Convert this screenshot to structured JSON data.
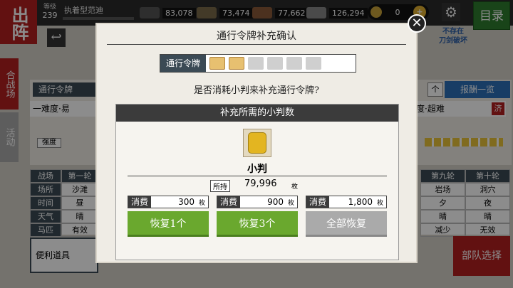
{
  "topbar": {
    "sortie": "出阵",
    "level_label": "等级",
    "level": "239",
    "player_name": "执着型范迪",
    "resources": [
      {
        "icon": "charcoal-icon",
        "value": "83,078"
      },
      {
        "icon": "steel-icon",
        "value": "73,474"
      },
      {
        "icon": "cooling-material-icon",
        "value": "77,662"
      },
      {
        "icon": "whetstone-icon",
        "value": "126,294"
      }
    ],
    "coins": "0",
    "menu": "目录"
  },
  "background": {
    "side_tab_1": "合战场",
    "side_tab_2": "活动",
    "pass_tab": "通行令牌",
    "difficulty_left": "一难度·易",
    "difficulty_right": "度·超难",
    "difficulty_right_badge": "济",
    "strength": "强度",
    "reward_list": "报酬一览",
    "count_suffix": "个",
    "not_exist": "不存在\n刀剑破坏",
    "left_table": {
      "header": [
        "战场",
        "第一轮"
      ],
      "rows": [
        [
          "场所",
          "沙滩"
        ],
        [
          "时间",
          "昼"
        ],
        [
          "天气",
          "晴"
        ],
        [
          "马匹",
          "有效"
        ]
      ]
    },
    "right_table": {
      "header": [
        "第九轮",
        "第十轮"
      ],
      "rows": [
        [
          "岩场",
          "洞穴"
        ],
        [
          "夕",
          "夜"
        ],
        [
          "晴",
          "晴"
        ],
        [
          "减少",
          "无效"
        ]
      ]
    },
    "items_label": "便利道具",
    "party_select": "部队选择"
  },
  "modal": {
    "title": "通行令牌补充确认",
    "pass_label": "通行令牌",
    "passes": [
      true,
      true,
      false,
      false,
      false,
      false
    ],
    "question": "是否消耗小判来补充通行令牌?",
    "section_title": "补充所需的小判数",
    "item_name": "小判",
    "hold_label": "所持",
    "hold_value": "79,996",
    "unit": "枚",
    "options": [
      {
        "consume_label": "消费",
        "cost": "300",
        "unit": "枚",
        "button": "恢复1个",
        "enabled": true
      },
      {
        "consume_label": "消费",
        "cost": "900",
        "unit": "枚",
        "button": "恢复3个",
        "enabled": true
      },
      {
        "consume_label": "消费",
        "cost": "1,800",
        "unit": "枚",
        "button": "全部恢复",
        "enabled": false
      }
    ]
  },
  "colors": {
    "accent_red": "#b22020",
    "button_green": "#6aa82e",
    "header_dark": "#3b4a55"
  }
}
